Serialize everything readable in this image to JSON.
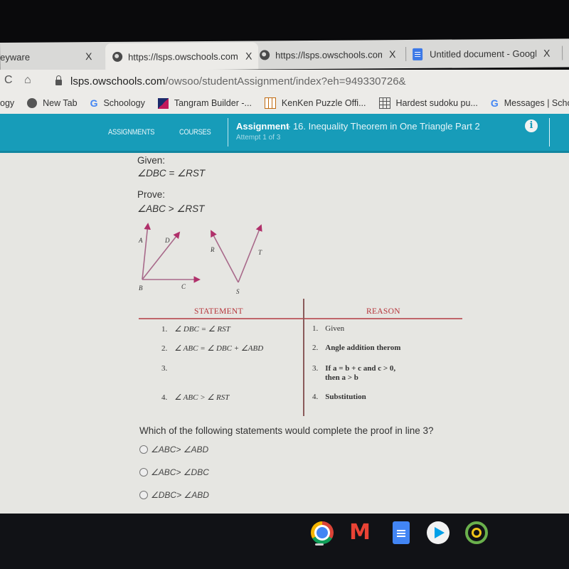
{
  "browser": {
    "tabs": [
      {
        "title": "Edgenuity / Gleeyware",
        "visible_title": "eyware",
        "close": "X"
      },
      {
        "title": "https://lsps.owschools.com",
        "close": "X",
        "active": true
      },
      {
        "title": "https://lsps.owschools.com",
        "close": "X"
      },
      {
        "title": "Untitled document - Google",
        "close": "X"
      }
    ],
    "nav": {
      "reload": "C",
      "home": "⌂"
    },
    "address": {
      "host": "lsps.owschools.com",
      "path": "/owsoo/studentAssignment/index?eh=949330726&"
    },
    "bookmarks": [
      {
        "label": "ogy",
        "icon": "none"
      },
      {
        "label": "New Tab",
        "icon": "globe-icon"
      },
      {
        "label": "Schoology",
        "icon": "google-icon"
      },
      {
        "label": "Tangram Builder -...",
        "icon": "tangram-icon"
      },
      {
        "label": "KenKen Puzzle Offi...",
        "icon": "kenken-icon"
      },
      {
        "label": "Hardest sudoku pu...",
        "icon": "sudoku-icon"
      },
      {
        "label": "Messages | School...",
        "icon": "google-icon"
      }
    ]
  },
  "site": {
    "nav": {
      "assignments": "ASSIGNMENTS",
      "courses": "COURSES"
    },
    "assignment_label": "Assignment",
    "assignment_title": "- 16. Inequality Theorem in One Triangle Part 2",
    "attempt": "Attempt 1 of 3",
    "info_icon": "i",
    "colors": {
      "header": "#179cb9",
      "table_header": "#b5343a"
    }
  },
  "problem": {
    "given_label": "Given:",
    "given": "∠DBC = ∠RST",
    "prove_label": "Prove:",
    "prove": "∠ABC > ∠RST",
    "figure_labels": {
      "A": "A",
      "B": "B",
      "C": "C",
      "D": "D",
      "R": "R",
      "S": "S",
      "T": "T"
    },
    "table": {
      "headers": {
        "statement": "STATEMENT",
        "reason": "REASON"
      },
      "rows": [
        {
          "n": "1.",
          "statement": "∠ DBC  =  ∠ RST",
          "reason_n": "1.",
          "reason": "Given"
        },
        {
          "n": "2.",
          "statement": "∠ ABC  =  ∠ DBC   + ∠ABD",
          "reason_n": "2.",
          "reason": "Angle addition therom"
        },
        {
          "n": "3.",
          "statement": "",
          "reason_n": "3.",
          "reason": "If a = b + c and c > 0,",
          "reason_line2": "then      a > b"
        },
        {
          "n": "4.",
          "statement": "∠ ABC  > ∠ RST",
          "reason_n": "4.",
          "reason": "Substitution"
        }
      ]
    },
    "question": "Which of the following statements would complete the proof in line 3?",
    "options": [
      {
        "label": "∠ABC> ∠ABD",
        "selected": false
      },
      {
        "label": "∠ABC> ∠DBC",
        "selected": false
      },
      {
        "label": "∠DBC> ∠ABD",
        "selected": false
      }
    ]
  },
  "shelf": {
    "apps": [
      "Chrome",
      "Gmail",
      "Docs",
      "Play Store",
      "Classlink"
    ]
  }
}
